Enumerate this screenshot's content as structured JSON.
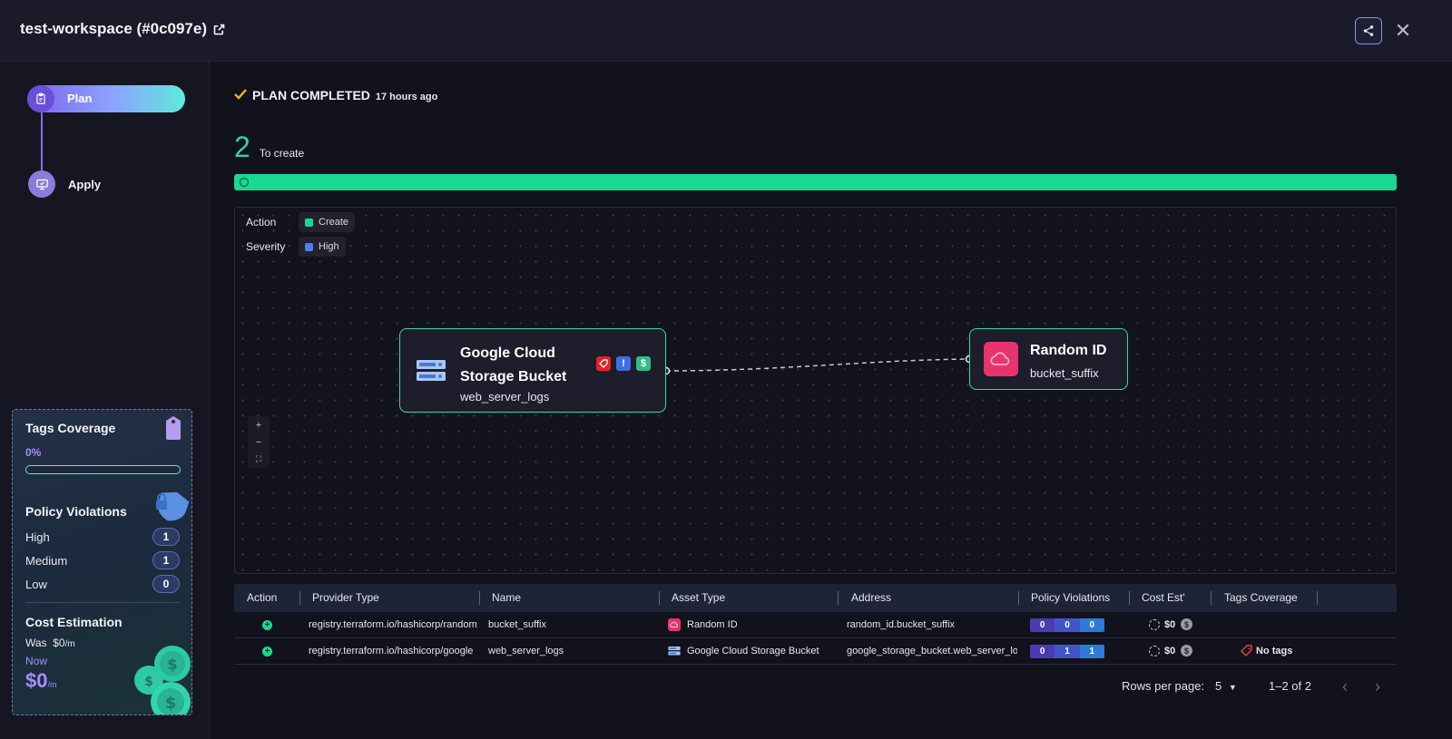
{
  "header": {
    "title": "test-workspace (#0c097e)",
    "icons": [
      "external-link-icon",
      "share-icon",
      "close-icon"
    ]
  },
  "sidebar": {
    "steps": [
      {
        "label": "Plan",
        "icon": "clipboard-icon",
        "active": true
      },
      {
        "label": "Apply",
        "icon": "monitor-check-icon",
        "active": false
      }
    ],
    "stats": {
      "tags_coverage": {
        "title": "Tags Coverage",
        "value": "0%",
        "fraction": 0
      },
      "policy_violations": {
        "title": "Policy Violations",
        "rows": [
          {
            "label": "High",
            "count": "1"
          },
          {
            "label": "Medium",
            "count": "1"
          },
          {
            "label": "Low",
            "count": "0"
          }
        ]
      },
      "cost_estimation": {
        "title": "Cost Estimation",
        "was_label": "Was",
        "was_value": "$0",
        "was_unit": "/m",
        "now_label": "Now",
        "now_value": "$0",
        "now_unit": "/m"
      }
    }
  },
  "main": {
    "status": {
      "label": "PLAN COMPLETED",
      "time": "17 hours ago"
    },
    "summary": {
      "count": "2",
      "label": "To create"
    },
    "graph": {
      "legend": [
        {
          "label": "Action",
          "chip": "Create",
          "color": "#18d993"
        },
        {
          "label": "Severity",
          "chip": "High",
          "color": "#4b7ff0"
        }
      ],
      "nodes": [
        {
          "title_line1": "Google Cloud",
          "title_line2": "Storage Bucket",
          "subtitle": "web_server_logs",
          "icon": "storage-bucket-icon",
          "badges": [
            "tag-icon",
            "alert-icon",
            "dollar-icon"
          ]
        },
        {
          "title_line1": "Random ID",
          "subtitle": "bucket_suffix",
          "icon": "cloud-icon"
        }
      ],
      "zoom": [
        "+",
        "−",
        "⛶"
      ]
    },
    "table": {
      "columns": [
        "Action",
        "Provider Type",
        "Name",
        "Asset Type",
        "Address",
        "Policy Violations",
        "Cost Est'",
        "Tags Coverage"
      ],
      "rows": [
        {
          "provider": "registry.terraform.io/hashicorp/random",
          "name": "bucket_suffix",
          "asset_type": "Random ID",
          "asset_icon": "cloud-icon",
          "address": "random_id.bucket_suffix",
          "violations": [
            "0",
            "0",
            "0"
          ],
          "cost": "$0",
          "tags": ""
        },
        {
          "provider": "registry.terraform.io/hashicorp/google",
          "name": "web_server_logs",
          "asset_type": "Google Cloud Storage Bucket",
          "asset_icon": "storage-bucket-icon",
          "address": "google_storage_bucket.web_server_logs",
          "violations": [
            "0",
            "1",
            "1"
          ],
          "cost": "$0",
          "tags": "No tags"
        }
      ]
    },
    "pagination": {
      "rows_per_page_label": "Rows per page:",
      "rows_per_page": "5",
      "range": "1–2 of 2"
    }
  }
}
